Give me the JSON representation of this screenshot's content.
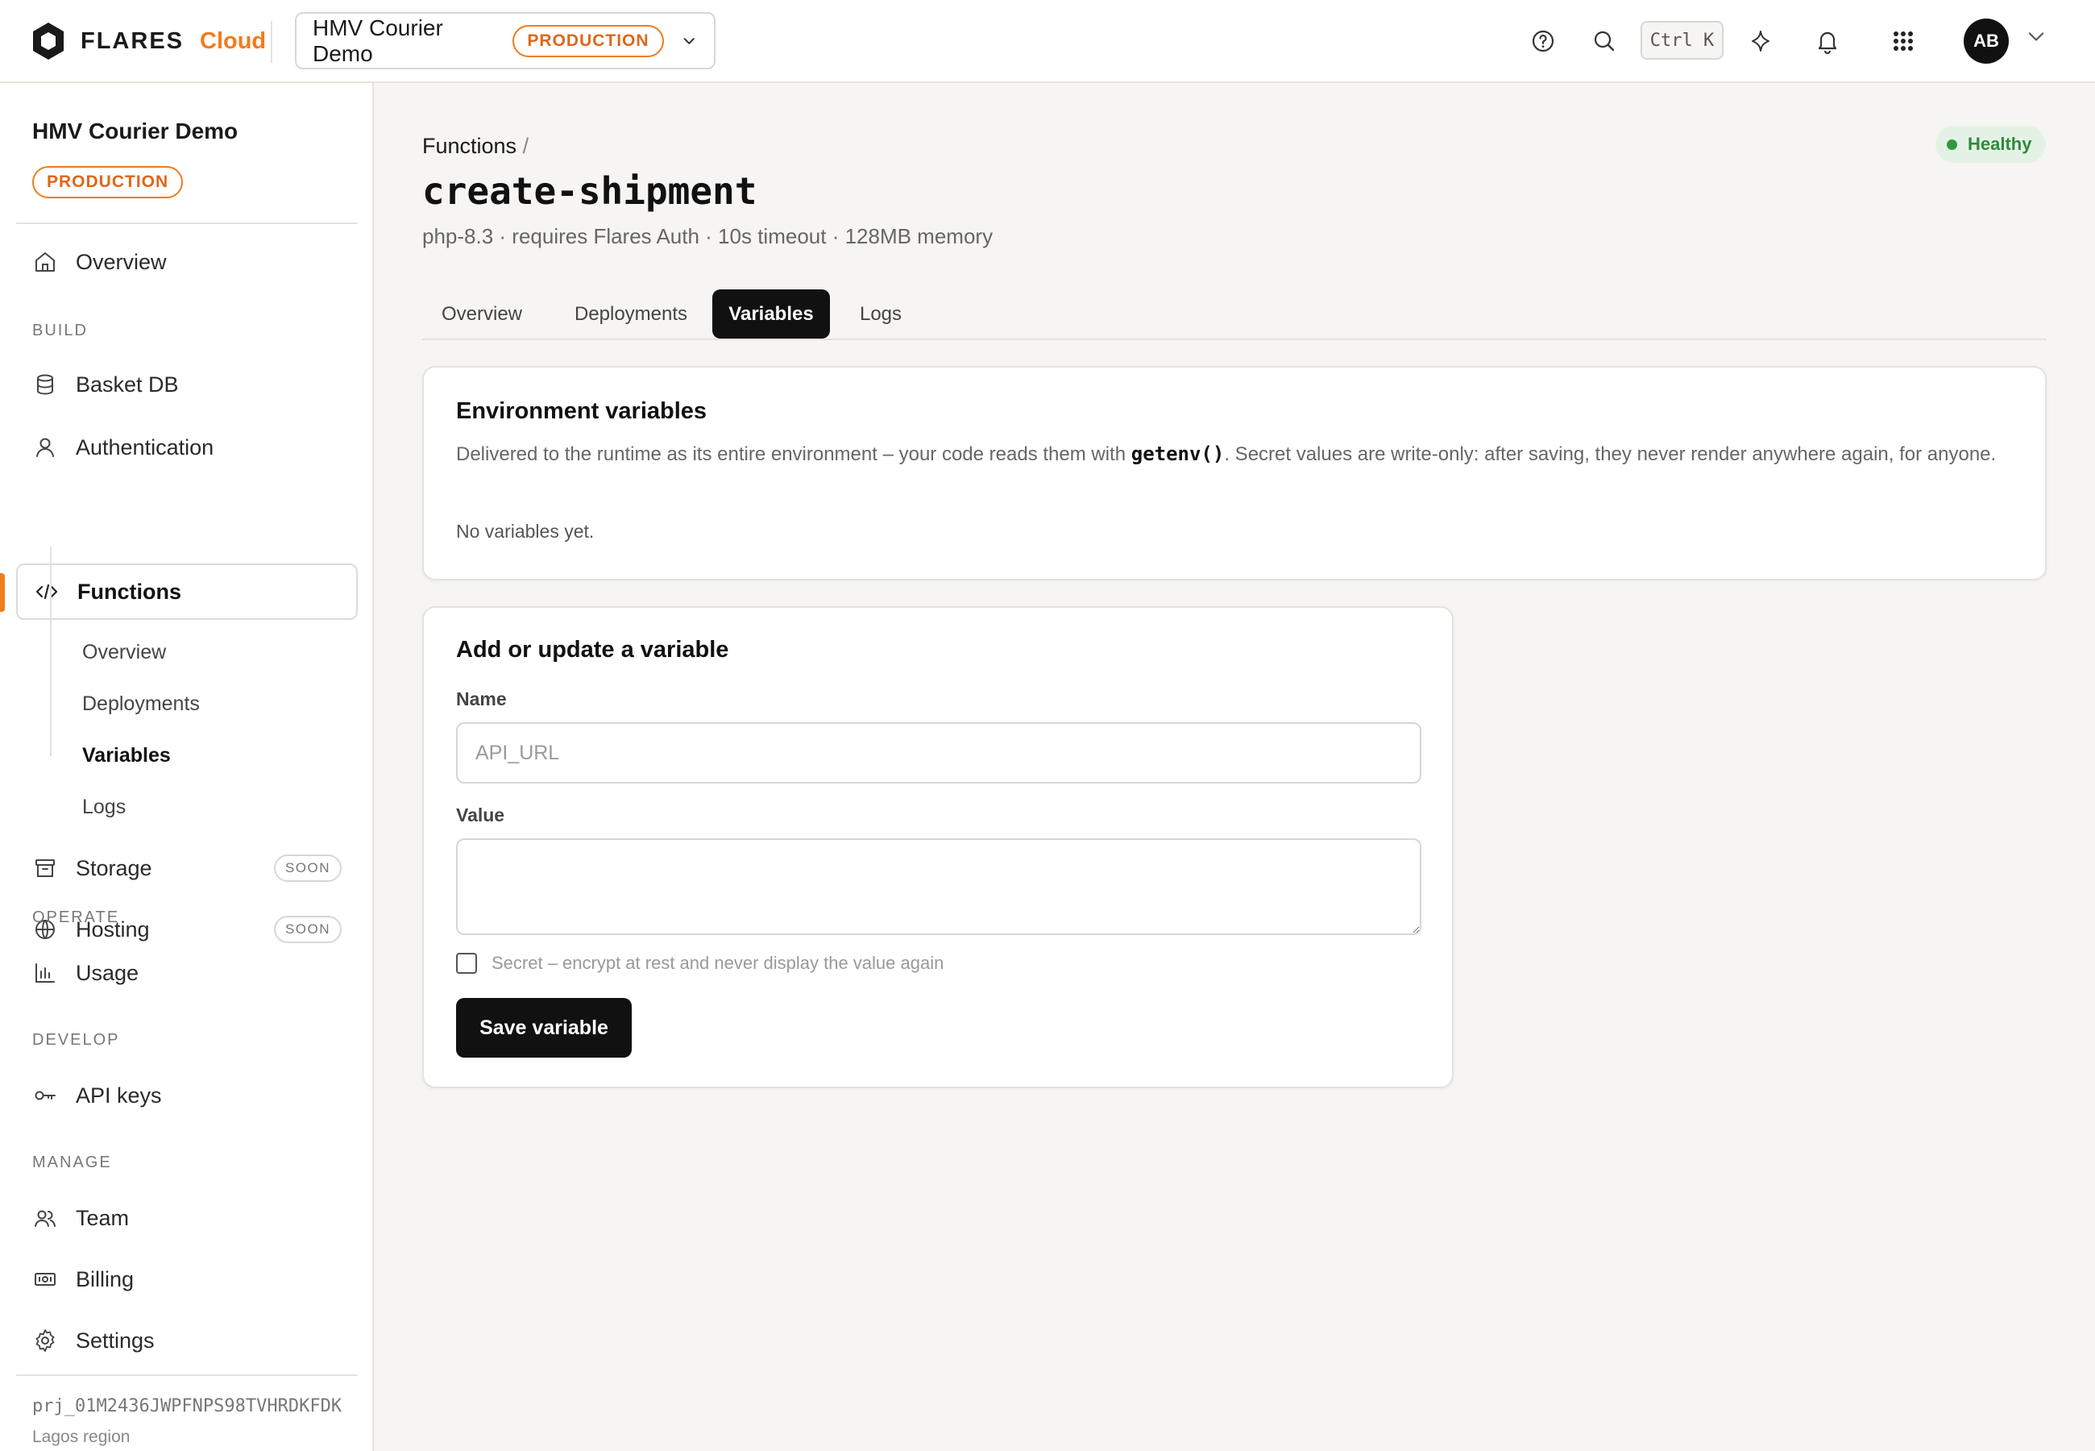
{
  "brand": {
    "name": "FLARES",
    "product": "Cloud"
  },
  "project": {
    "name": "HMV Courier Demo",
    "env": "PRODUCTION",
    "id": "prj_01M2436JWPFNPS98TVHRDKFDK",
    "region": "Lagos region"
  },
  "topbar": {
    "shortcut": "Ctrl K",
    "avatar_initials": "AB"
  },
  "sidebar": {
    "overview": "Overview",
    "sections": {
      "build": "BUILD",
      "operate": "OPERATE",
      "develop": "DEVELOP",
      "manage": "MANAGE"
    },
    "build_items": {
      "basket_db": "Basket DB",
      "authentication": "Authentication",
      "functions": "Functions",
      "storage": "Storage",
      "hosting": "Hosting"
    },
    "soon_label": "SOON",
    "functions_sub": {
      "overview": "Overview",
      "deployments": "Deployments",
      "variables": "Variables",
      "logs": "Logs"
    },
    "operate_items": {
      "usage": "Usage"
    },
    "develop_items": {
      "api_keys": "API keys"
    },
    "manage_items": {
      "team": "Team",
      "billing": "Billing",
      "settings": "Settings"
    }
  },
  "page": {
    "breadcrumb": "Functions",
    "breadcrumb_sep": "/",
    "title": "create-shipment",
    "meta": "php-8.3 · requires Flares Auth · 10s timeout · 128MB memory",
    "status": "Healthy",
    "tabs": {
      "overview": "Overview",
      "deployments": "Deployments",
      "variables": "Variables",
      "logs": "Logs"
    }
  },
  "env_card": {
    "title": "Environment variables",
    "desc_before": "Delivered to the runtime as its entire environment – your code reads them with ",
    "desc_code": "getenv()",
    "desc_after": ". Secret values are write-only: after saving, they never render anywhere again, for anyone.",
    "empty": "No variables yet."
  },
  "form": {
    "title": "Add or update a variable",
    "name_label": "Name",
    "name_placeholder": "API_URL",
    "name_value": "",
    "value_label": "Value",
    "value_value": "",
    "secret_label": "Secret – encrypt at rest and never display the value again",
    "secret_checked": false,
    "save_label": "Save variable"
  },
  "colors": {
    "accent": "#f07c1e",
    "healthy": "#2e8a3c",
    "healthy_bg": "#e4f2e6",
    "active_tab": "#111111"
  }
}
